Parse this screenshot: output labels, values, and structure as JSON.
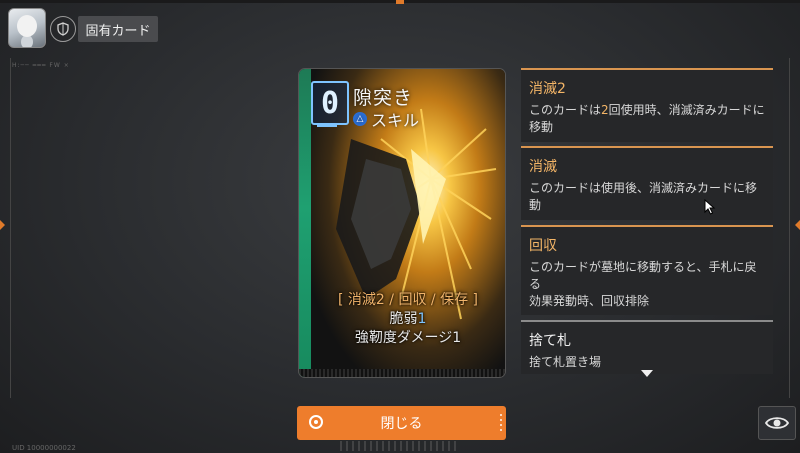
{
  "header": {
    "avatar_icon": "character-portrait-icon",
    "shield_icon": "shield-icon",
    "tab_label": "固有カード",
    "tiny_label": "H:── ═══ FW  ×",
    "tiny_code": "UID 10000000022"
  },
  "card": {
    "cost": "0",
    "name": "隙突き",
    "type_icon": "skill-icon",
    "type_icon_glyph": "△",
    "type": "スキル",
    "keywords": "[ 消滅2 / 回収 / 保存 ]",
    "effect_line1_text": "脆弱",
    "effect_line1_num": "1",
    "effect_line2": "強靭度ダメージ1"
  },
  "panels": [
    {
      "title": "消滅2",
      "desc_pre": "このカードは",
      "desc_hl": "2",
      "desc_post": "回使用時、消滅済みカードに移動"
    },
    {
      "title": "消滅",
      "desc": "このカードは使用後、消滅済みカードに移動"
    },
    {
      "title": "回収",
      "desc_line1": "このカードが墓地に移動すると、手札に戻る",
      "desc_line2": "効果発動時、回収排除"
    },
    {
      "title": "捨て札",
      "desc": "捨て札置き場"
    }
  ],
  "footer": {
    "close_label": "閉じる",
    "eye_icon": "eye-icon"
  },
  "colors": {
    "accent_orange": "#ee7d2c",
    "keyword_orange": "#f3b567",
    "cost_blue": "#7ec4ff",
    "strip_green": "#1fa071"
  }
}
